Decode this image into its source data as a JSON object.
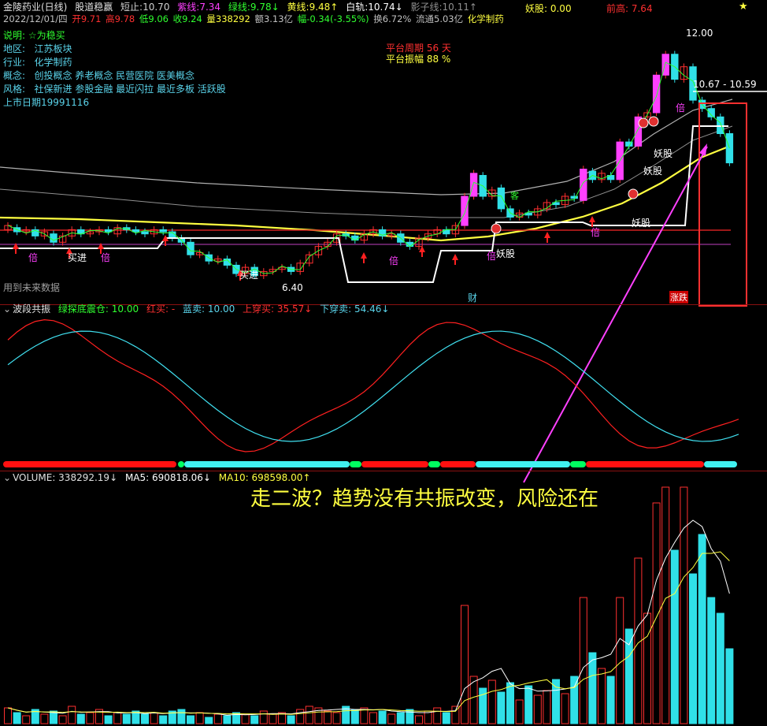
{
  "header": {
    "stock_name": "金陵药业(日线)",
    "indicator": "股道稳赢",
    "items": [
      {
        "label": "短止:",
        "value": "10.70",
        "color": "#d0d0d0"
      },
      {
        "label": "紫线:",
        "value": "7.34",
        "color": "#ff40ff"
      },
      {
        "label": "绿线:",
        "value": "9.78↓",
        "color": "#30ff30"
      },
      {
        "label": "黄线:",
        "value": "9.48↑",
        "color": "#ffff40"
      },
      {
        "label": "白轨:",
        "value": "10.74↓",
        "color": "#ffffff"
      },
      {
        "label": "影子线:",
        "value": "10.11↑",
        "color": "#909090"
      }
    ],
    "yaogu": "妖股: 0.00",
    "qiangao": "前高: 7.64"
  },
  "quote": {
    "date": "2022/12/01/四",
    "open": "开9.71",
    "high": "高9.78",
    "low": "低9.06",
    "close": "收9.24",
    "vol": "量338292",
    "amount": "额3.13亿",
    "change": "幅-0.34(-3.55%)",
    "turnover": "换6.72%",
    "float": "流通5.03亿",
    "industry": "化学制药"
  },
  "info": {
    "desc_label": "说明:",
    "desc_val": "☆为稳买",
    "region_label": "地区:",
    "region_val": "江苏板块",
    "industry_label": "行业:",
    "industry_val": "化学制药",
    "concept_label": "概念:",
    "concept_val": "创投概念 养老概念 民营医院 医美概念",
    "style_label": "风格:",
    "style_val": "社保新进 参股金融 最近闪拉 最近多板 活跃股",
    "listing": "上市日期19991116"
  },
  "platform": {
    "period": "平台周期 56 天",
    "amplitude": "平台振幅 88 %"
  },
  "annotations": {
    "high_price": "12.00",
    "range": "10.67 - 10.59",
    "low_price": "6.40",
    "future_data": "用到未来数据",
    "cai": "财",
    "zhangdie": "涨跌",
    "buy1": "买进",
    "buy2": "买进",
    "bei": "倍",
    "yao": "妖股",
    "ke": "客"
  },
  "oscillator": {
    "title": "波段共振",
    "green_label": "绿探底震仓:",
    "green_val": "10.00",
    "red_buy": "红买: -",
    "blue_sell": "蓝卖: 10.00",
    "up_cross": "上穿买: 35.57↓",
    "down_cross": "下穿卖: 54.46↓"
  },
  "volume": {
    "title": "VOLUME: 338292.19↓",
    "ma5": "MA5: 690818.06↓",
    "ma10": "MA10: 698598.00↑"
  },
  "caption": "走二波？趋势没有共振改变，风险还在",
  "colors": {
    "up": "#ff3030",
    "down": "#30e0e8",
    "yellow": "#ffff40",
    "white": "#ffffff",
    "magenta": "#ff40ff",
    "green": "#30ff30"
  }
}
